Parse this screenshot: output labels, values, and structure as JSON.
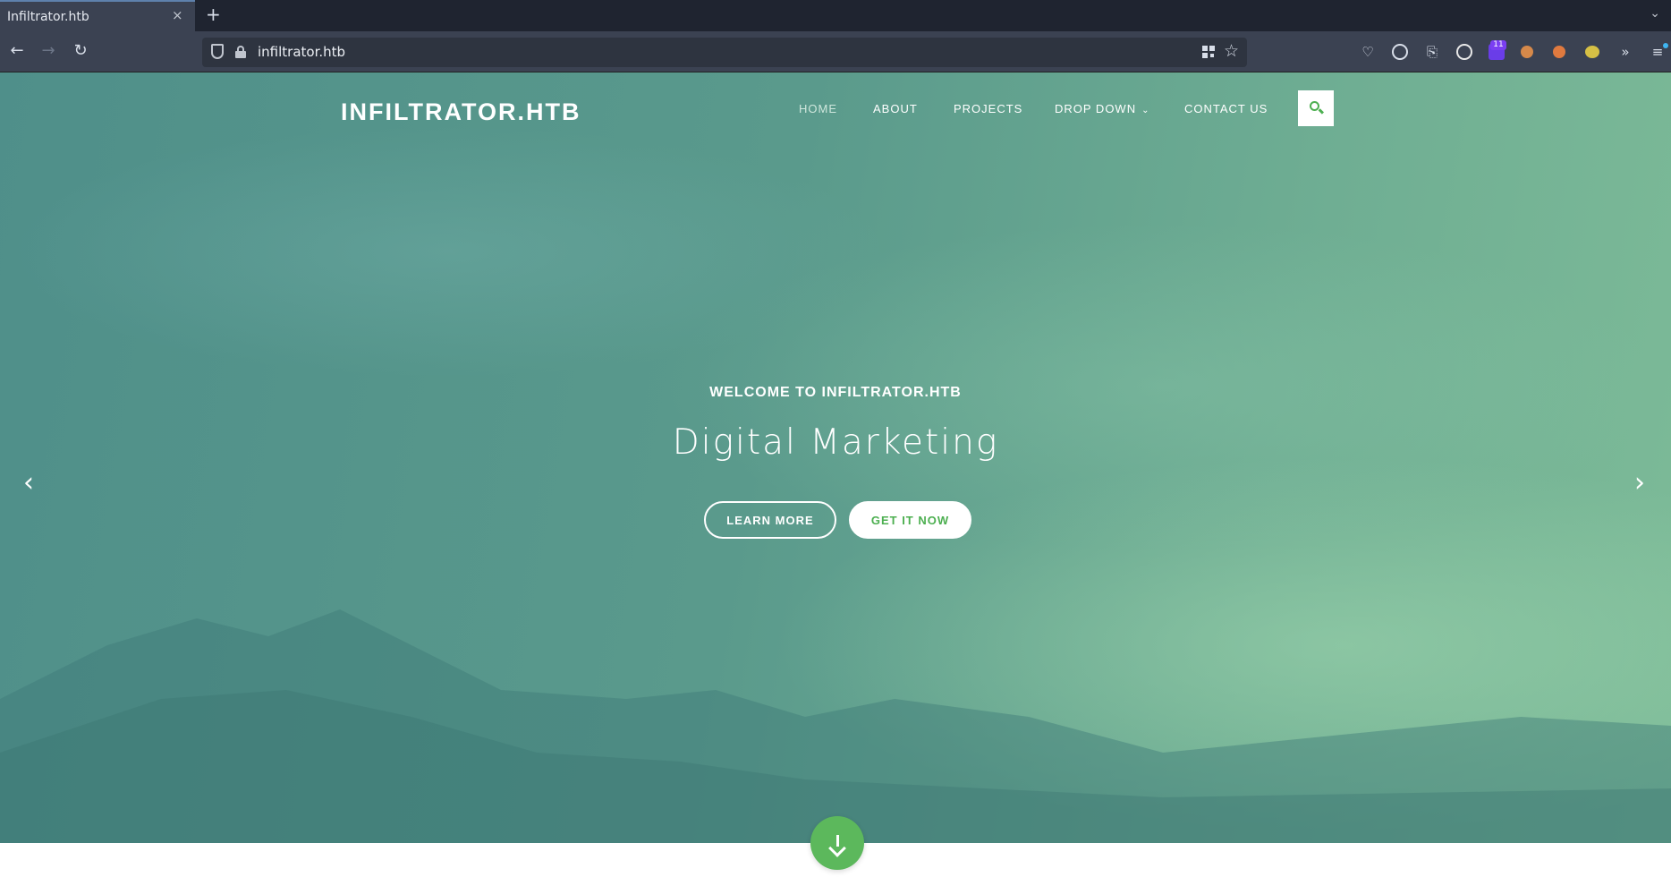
{
  "browser": {
    "tab_title": "Infiltrator.htb",
    "tab_close": "×",
    "new_tab": "+",
    "url": "infiltrator.htb",
    "extension_badge": "11"
  },
  "site": {
    "brand": "INFILTRATOR.HTB",
    "menu": [
      "HOME",
      "ABOUT",
      "PROJECTS",
      "DROP DOWN",
      "CONTACT US"
    ],
    "active_menu": "HOME",
    "dropdown_caret": "⌄"
  },
  "hero": {
    "welcome": "WELCOME TO INFILTRATOR.HTB",
    "headline": "Digital Marketing",
    "learn_more": "LEARN MORE",
    "get_it_now": "GET IT NOW",
    "prev_arrow": "‹",
    "next_arrow": "›"
  },
  "colors": {
    "accent": "#4caf50",
    "hero_tint": "#5a9a8c"
  },
  "icons": [
    "back-icon",
    "forward-icon",
    "reload-icon",
    "shield-icon",
    "lock-icon",
    "qr-icon",
    "star-icon",
    "pocket-icon",
    "account-icon",
    "extensions-icon",
    "search-icon",
    "chevron-left-icon",
    "chevron-right-icon",
    "arrow-down-icon"
  ]
}
